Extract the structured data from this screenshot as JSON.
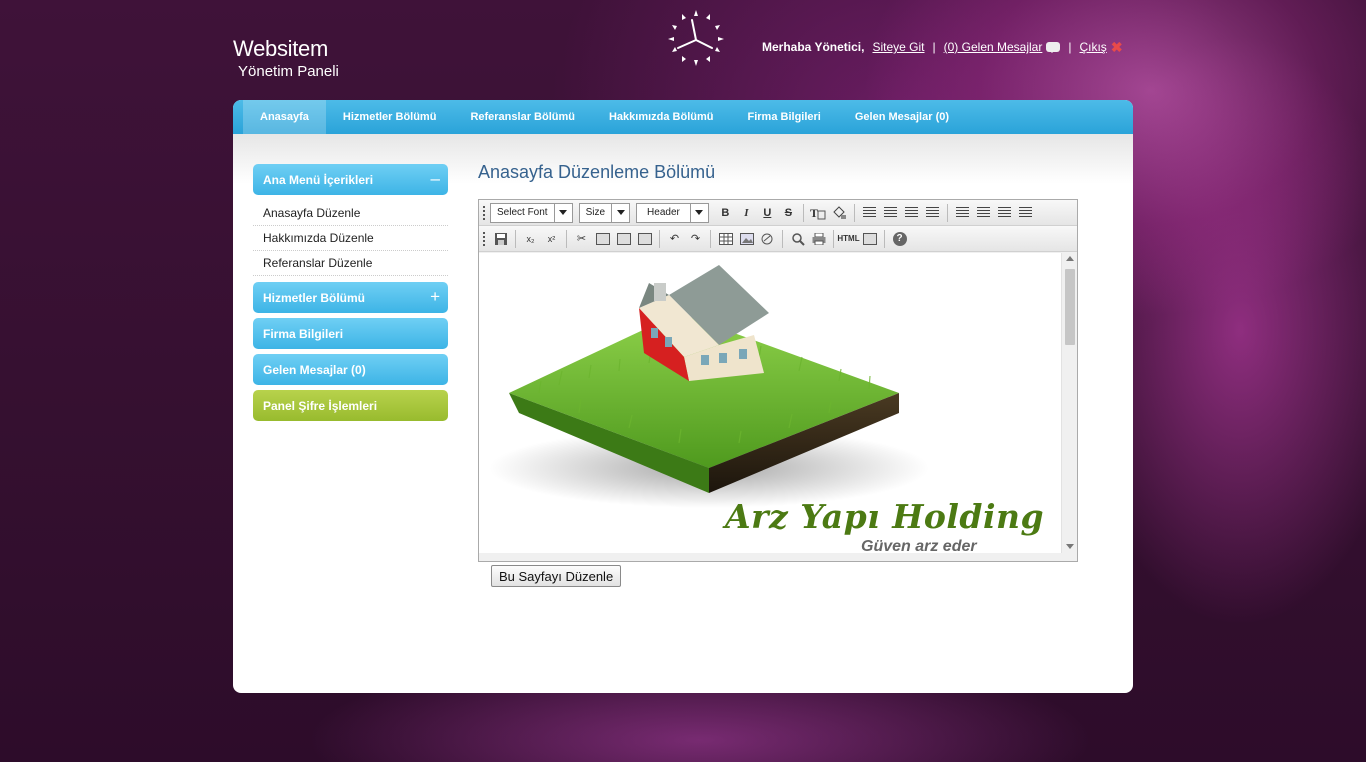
{
  "site": {
    "title": "Websitem",
    "subtitle": "Yönetim Paneli"
  },
  "topbar": {
    "greeting": "Merhaba Yönetici,",
    "site_link": "Siteye Git",
    "messages_link": "(0) Gelen Mesajlar",
    "logout": "Çıkış",
    "separator": "|"
  },
  "nav": {
    "tabs": [
      {
        "label": "Anasayfa",
        "active": true
      },
      {
        "label": "Hizmetler Bölümü"
      },
      {
        "label": "Referanslar Bölümü"
      },
      {
        "label": "Hakkımızda Bölümü"
      },
      {
        "label": "Firma Bilgileri"
      },
      {
        "label": "Gelen Mesajlar (0)"
      }
    ]
  },
  "sidebar": {
    "main_menu": {
      "label": "Ana Menü İçerikleri",
      "sign": "–"
    },
    "sub_items": [
      "Anasayfa Düzenle",
      "Hakkımızda Düzenle",
      "Referanslar Düzenle"
    ],
    "services": {
      "label": "Hizmetler Bölümü",
      "sign": "+"
    },
    "company": "Firma Bilgileri",
    "messages": "Gelen Mesajlar (0)",
    "password": "Panel Şifre İşlemleri"
  },
  "content": {
    "heading": "Anasayfa Düzenleme Bölümü",
    "toolbar": {
      "font_select": "Select Font",
      "size_select": "Size",
      "header_select": "Header",
      "bold": "B",
      "italic": "I",
      "underline": "U",
      "strike": "S",
      "subscript": "x₂",
      "superscript": "x²",
      "html": "HTML",
      "help": "?"
    },
    "editor_image": {
      "brand": "Arz Yapı Holding",
      "tagline": "Güven arz eder"
    },
    "submit_label": "Bu Sayfayı Düzenle"
  },
  "colors": {
    "nav_blue": "#2aa3d9",
    "sidebar_blue": "#3db4e6",
    "sidebar_green": "#98bb2e",
    "heading_blue": "#36628e",
    "background": "#3a0f35"
  }
}
